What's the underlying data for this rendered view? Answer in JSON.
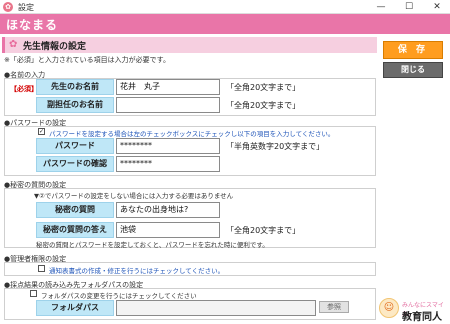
{
  "window": {
    "title": "設定",
    "min": "—",
    "max": "☐",
    "close": "✕"
  },
  "app": {
    "name": "ほなまる"
  },
  "section": {
    "title": "先生情報の設定",
    "icon": "flower-icon",
    "note": "※「必須」と入力されている項目は入力が必要です。"
  },
  "actions": {
    "save": "保 存",
    "close": "閉じる"
  },
  "name_group": {
    "label": "●名前の入力",
    "required": "【必須】",
    "teacher_name_label": "先生のお名前",
    "teacher_name_value": "花井　丸子",
    "teacher_name_hint": "「全角20文字まで」",
    "sub_name_label": "副担任のお名前",
    "sub_name_value": "",
    "sub_name_hint": "「全角20文字まで」"
  },
  "password_group": {
    "label": "●パスワードの設定",
    "checkbox_text": "パスワードを設定する場合は左のチェックボックスにチェックし以下の項目を入力してください。",
    "checkbox_checked": "✓",
    "password_label": "パスワード",
    "password_value": "********",
    "password_hint": "「半角英数字20文字まで」",
    "confirm_label": "パスワードの確認",
    "confirm_value": "********"
  },
  "secret_group": {
    "label": "●秘密の質問の設定",
    "note": "▼②でパスワードの設定をしない場合には入力する必要はありません",
    "question_label": "秘密の質問",
    "question_value": "あなたの出身地は?",
    "answer_label": "秘密の質問の答え",
    "answer_value": "池袋",
    "answer_hint": "「全角20文字まで」",
    "footer": "秘密の質問とパスワードを設定しておくと、パスワードを忘れた時に便利です。"
  },
  "admin_group": {
    "label": "●管理者権限の設定",
    "checkbox_text": "通知表書式の作成・修正を行うにはチェックしてください。"
  },
  "folder_group": {
    "label": "●採点結果の読み込み先フォルダパスの設定",
    "checkbox_text": "フォルダパスの変更を行うにはチェックしてください",
    "folder_label": "フォルダパス",
    "folder_value": "",
    "ref_button": "参照"
  },
  "logo": {
    "tagline": "みんなにスマイル。",
    "name": "教育同人社"
  },
  "colors": {
    "brand": "#e975a8",
    "save": "#ff9d1f",
    "label_bg": "#bfe7f7"
  }
}
